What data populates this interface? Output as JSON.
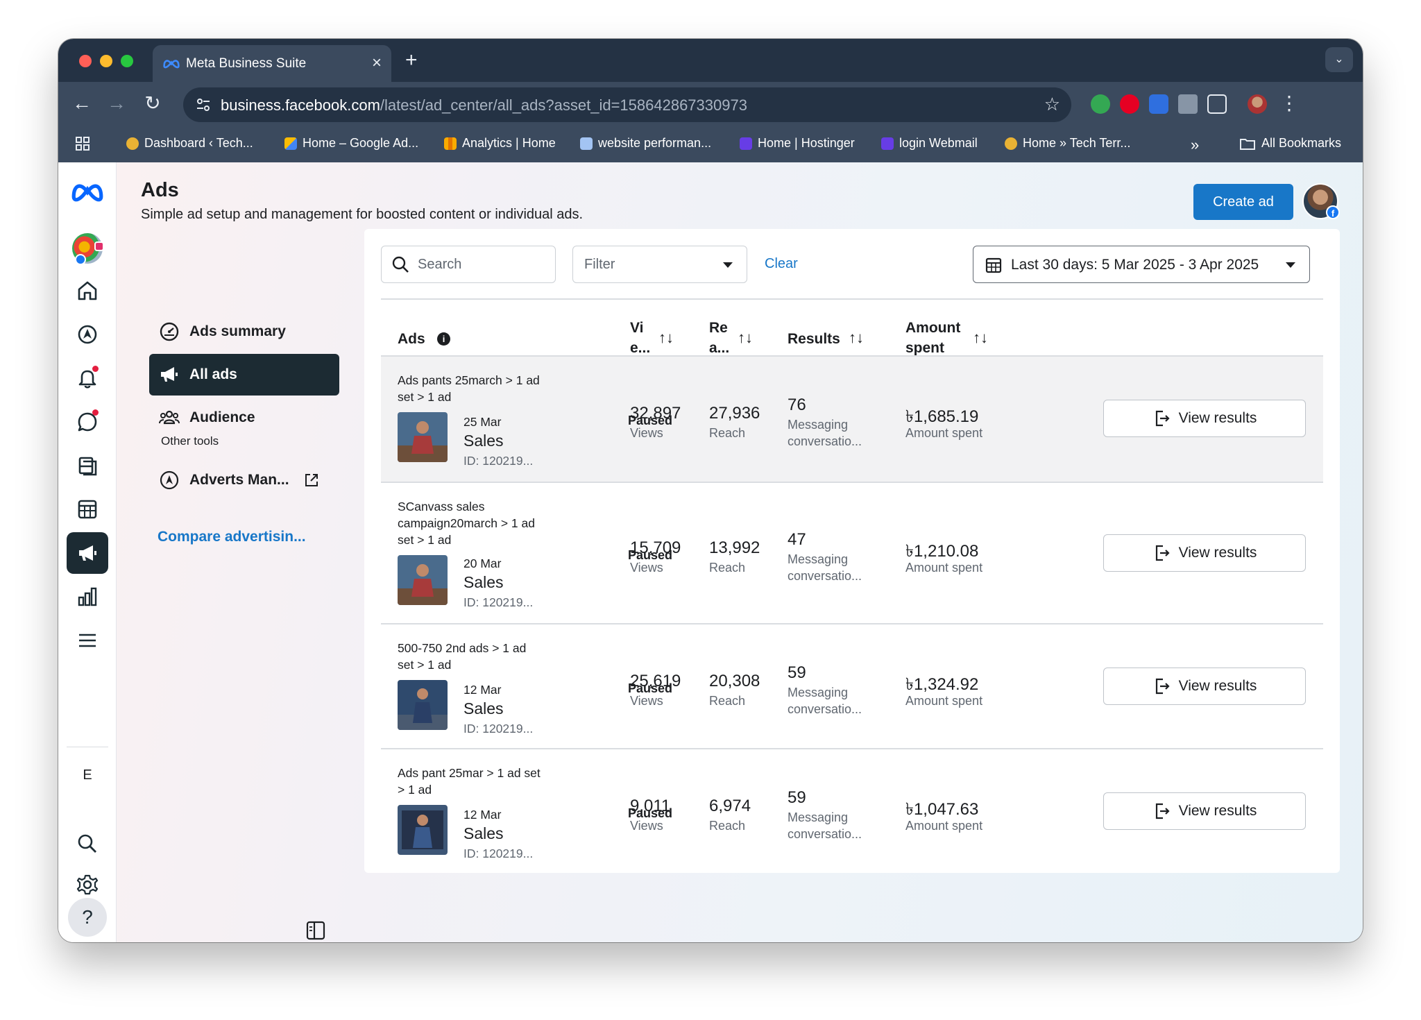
{
  "browser": {
    "tab_title": "Meta Business Suite",
    "tab_close": "×",
    "new_tab": "+",
    "url_host": "business.facebook.com",
    "url_path": "/latest/ad_center/all_ads?asset_id=158642867330973",
    "bookmarks": [
      {
        "label": "Dashboard ‹ Tech...",
        "icon": "tech-terms-icon",
        "color": "#e9b234"
      },
      {
        "label": "Home – Google Ad...",
        "icon": "google-ads-icon",
        "color": "#4285f4"
      },
      {
        "label": "Analytics | Home",
        "icon": "analytics-icon",
        "color": "#f9ab00"
      },
      {
        "label": "website performan...",
        "icon": "pagespeed-icon",
        "color": "#a3c4f3"
      },
      {
        "label": "Home | Hostinger",
        "icon": "hostinger-icon",
        "color": "#673de6"
      },
      {
        "label": "login Webmail",
        "icon": "hostinger-icon",
        "color": "#673de6"
      },
      {
        "label": "Home » Tech Terr...",
        "icon": "tech-terms-icon",
        "color": "#e9b234"
      }
    ],
    "more_bookmarks": "»",
    "all_bookmarks": "All Bookmarks"
  },
  "header": {
    "title": "Ads",
    "subtitle": "Simple ad setup and management for boosted content or individual ads.",
    "create_button": "Create ad",
    "badge": "f"
  },
  "rail": {
    "letter": "E",
    "help": "?"
  },
  "menu": {
    "items": [
      {
        "label": "Ads summary"
      },
      {
        "label": "All ads"
      },
      {
        "label": "Audience"
      }
    ],
    "other_tools": "Other tools",
    "adverts_manager": "Adverts Man...",
    "compare": "Compare advertisin..."
  },
  "toolbar": {
    "search_placeholder": "Search",
    "filter_placeholder": "Filter",
    "clear": "Clear",
    "date_range": "Last 30 days: 5 Mar 2025 - 3 Apr 2025"
  },
  "table": {
    "headers": {
      "ads": "Ads",
      "info": "i",
      "views_1": "Vi",
      "views_2": "e...",
      "reach_1": "Re",
      "reach_2": "a...",
      "results": "Results",
      "amount_1": "Amount",
      "amount_2": "spent",
      "sort": "↑↓"
    },
    "rows": [
      {
        "name_line1": "Ads pants 25march > 1 ad",
        "name_line2": "set > 1 ad",
        "name_line3": "",
        "date": "25 Mar",
        "objective": "Sales",
        "id": "ID: 120219...",
        "status": "Paused",
        "views": "32,897",
        "views_label": "Views",
        "reach": "27,936",
        "reach_label": "Reach",
        "results": "76",
        "results_label_1": "Messaging",
        "results_label_2": "conversatio...",
        "spent": "৳1,685.19",
        "spent_label": "Amount spent",
        "button": "View results"
      },
      {
        "name_line1": "SCanvass sales",
        "name_line2": "campaign20march > 1 ad",
        "name_line3": "set > 1 ad",
        "date": "20 Mar",
        "objective": "Sales",
        "id": "ID: 120219...",
        "status": "Paused",
        "views": "15,709",
        "views_label": "Views",
        "reach": "13,992",
        "reach_label": "Reach",
        "results": "47",
        "results_label_1": "Messaging",
        "results_label_2": "conversatio...",
        "spent": "৳1,210.08",
        "spent_label": "Amount spent",
        "button": "View results"
      },
      {
        "name_line1": "500-750 2nd ads > 1 ad",
        "name_line2": "set > 1 ad",
        "name_line3": "",
        "date": "12 Mar",
        "objective": "Sales",
        "id": "ID: 120219...",
        "status": "Paused",
        "views": "25,619",
        "views_label": "Views",
        "reach": "20,308",
        "reach_label": "Reach",
        "results": "59",
        "results_label_1": "Messaging",
        "results_label_2": "conversatio...",
        "spent": "৳1,324.92",
        "spent_label": "Amount spent",
        "button": "View results"
      },
      {
        "name_line1": "Ads pant 25mar > 1 ad set",
        "name_line2": "> 1 ad",
        "name_line3": "",
        "date": "12 Mar",
        "objective": "Sales",
        "id": "ID: 120219...",
        "status": "Paused",
        "views": "9,011",
        "views_label": "Views",
        "reach": "6,974",
        "reach_label": "Reach",
        "results": "59",
        "results_label_1": "Messaging",
        "results_label_2": "conversatio...",
        "spent": "৳1,047.63",
        "spent_label": "Amount spent",
        "button": "View results"
      }
    ]
  },
  "colors": {
    "accent": "#1877c8",
    "active_nav": "#1c2b33",
    "browser_chrome": "#3b4a5e"
  }
}
